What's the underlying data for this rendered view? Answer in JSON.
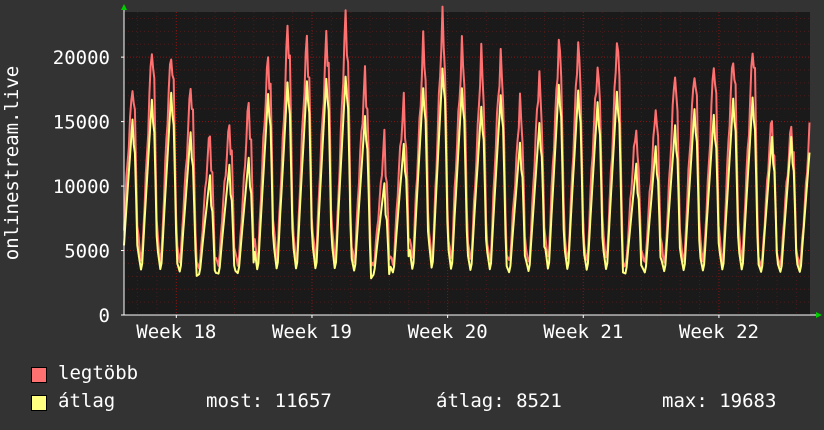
{
  "chart_data": {
    "type": "line",
    "ylabel": "onlinestream.live",
    "y_ticks": [
      0,
      5000,
      10000,
      15000,
      20000
    ],
    "ylim": [
      0,
      23500
    ],
    "x_tick_labels": [
      "Week 18",
      "Week 19",
      "Week 20",
      "Week 21",
      "Week 22"
    ],
    "x_range_days": [
      -2.7,
      32.7
    ],
    "x_tick_days": [
      0,
      7,
      14,
      21,
      28
    ],
    "grid": true,
    "series": [
      {
        "name": "legtöbb",
        "color": "#ff7070",
        "daily_peaks": [
          16500,
          18500,
          19200,
          15800,
          11500,
          12900,
          13800,
          18800,
          20200,
          19700,
          20100,
          20800,
          17200,
          10800,
          14500,
          19300,
          21000,
          19600,
          17800,
          18700,
          14300,
          16500,
          19900,
          18800,
          18100,
          19200,
          12300,
          14200,
          16600,
          17700,
          17300,
          18800,
          19000,
          12800
        ]
      },
      {
        "name": "átlag",
        "color": "#ffff80",
        "daily_peaks": [
          13300,
          15000,
          15600,
          12200,
          8500,
          9400,
          10000,
          15500,
          16500,
          16600,
          16800,
          17000,
          13600,
          7800,
          11200,
          16000,
          17700,
          16000,
          14400,
          15400,
          11300,
          13000,
          16300,
          15800,
          14800,
          15700,
          9500,
          11000,
          12800,
          14200,
          13700,
          15100,
          15200,
          11800
        ]
      }
    ]
  },
  "legend": {
    "items": [
      {
        "label": "legtöbb",
        "color": "#ff7070"
      },
      {
        "label": "átlag",
        "color": "#ffff80"
      }
    ],
    "stats": {
      "most": "most: 11657",
      "atlag": "átlag: 8521",
      "max": "max: 19683"
    }
  },
  "colors": {
    "background": "#333333",
    "plot_background": "#1a1a1a",
    "grid": "#7a1010",
    "axis": "#ffffff",
    "arrow": "#00cc00"
  }
}
